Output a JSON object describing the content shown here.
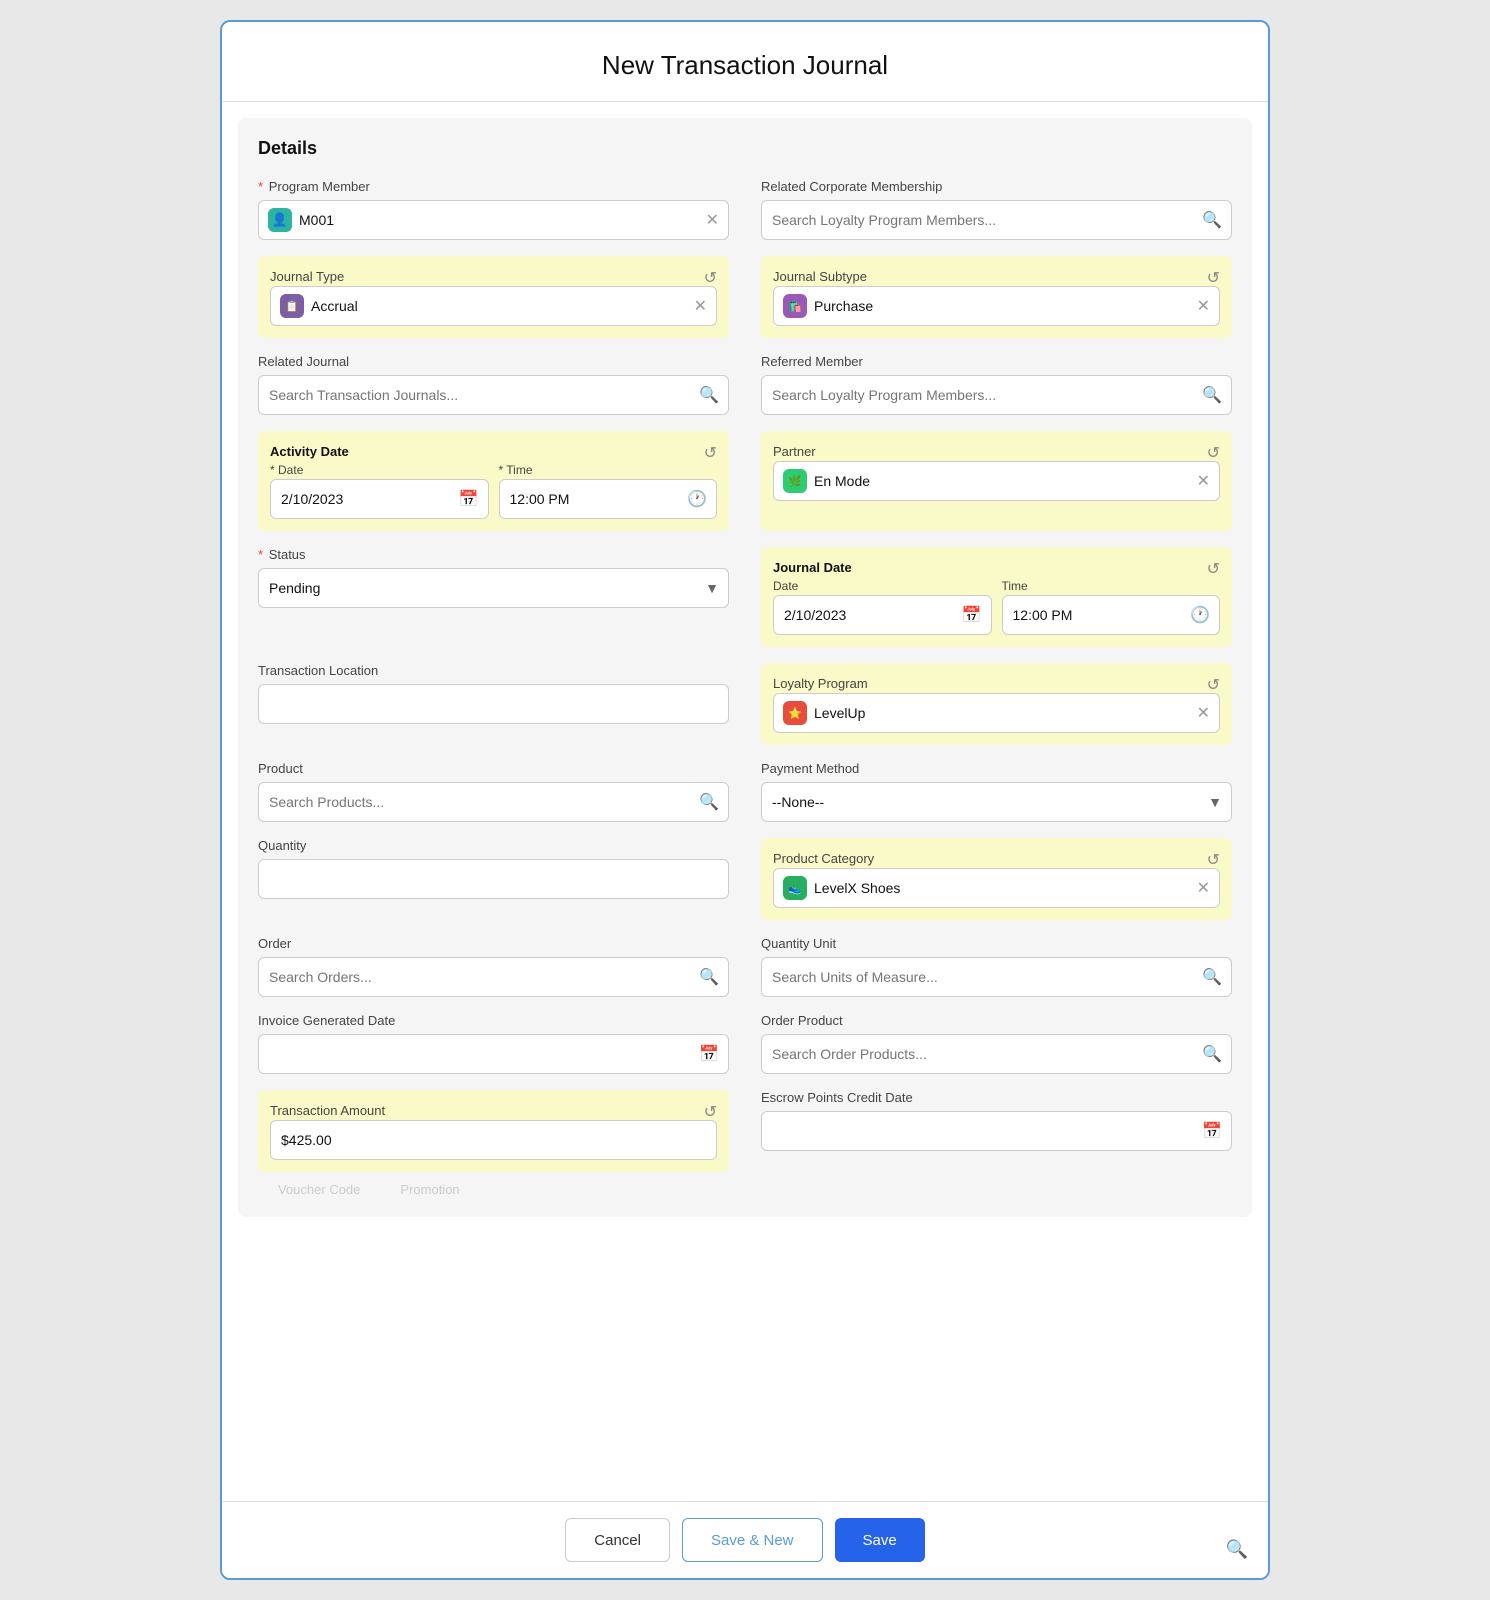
{
  "modal": {
    "title": "New Transaction Journal"
  },
  "section": {
    "title": "Details"
  },
  "fields": {
    "programMember": {
      "label": "Program Member",
      "required": true,
      "value": "M001",
      "iconType": "person"
    },
    "relatedCorporate": {
      "label": "Related Corporate Membership",
      "placeholder": "Search Loyalty Program Members..."
    },
    "journalType": {
      "label": "Journal Type",
      "value": "Accrual",
      "iconType": "accrual"
    },
    "journalSubtype": {
      "label": "Journal Subtype",
      "value": "Purchase",
      "iconType": "purchase"
    },
    "relatedJournal": {
      "label": "Related Journal",
      "placeholder": "Search Transaction Journals..."
    },
    "referredMember": {
      "label": "Referred Member",
      "placeholder": "Search Loyalty Program Members..."
    },
    "activityDate": {
      "label": "Activity Date",
      "dateLabel": "Date",
      "timeLabel": "Time",
      "dateValue": "2/10/2023",
      "timeValue": "12:00 PM"
    },
    "partner": {
      "label": "Partner",
      "value": "En Mode",
      "iconType": "enmode"
    },
    "status": {
      "label": "Status",
      "required": true,
      "value": "Pending"
    },
    "journalDate": {
      "label": "Journal Date",
      "dateLabel": "Date",
      "timeLabel": "Time",
      "dateValue": "2/10/2023",
      "timeValue": "12:00 PM"
    },
    "transactionLocation": {
      "label": "Transaction Location",
      "value": ""
    },
    "loyaltyProgram": {
      "label": "Loyalty Program",
      "value": "LevelUp",
      "iconType": "levelup"
    },
    "product": {
      "label": "Product",
      "placeholder": "Search Products..."
    },
    "paymentMethod": {
      "label": "Payment Method",
      "value": "--None--"
    },
    "quantity": {
      "label": "Quantity",
      "value": ""
    },
    "productCategory": {
      "label": "Product Category",
      "value": "LevelX Shoes",
      "iconType": "levelxshoes"
    },
    "order": {
      "label": "Order",
      "placeholder": "Search Orders..."
    },
    "quantityUnit": {
      "label": "Quantity Unit",
      "placeholder": "Search Units of Measure..."
    },
    "invoiceGeneratedDate": {
      "label": "Invoice Generated Date",
      "value": ""
    },
    "orderProduct": {
      "label": "Order Product",
      "placeholder": "Search Order Products..."
    },
    "transactionAmount": {
      "label": "Transaction Amount",
      "value": "$425.00"
    },
    "escrowPointsCreditDate": {
      "label": "Escrow Points Credit Date",
      "value": ""
    },
    "voucherCode": {
      "label": "Voucher Code"
    },
    "promotion": {
      "label": "Promotion"
    }
  },
  "footer": {
    "cancelLabel": "Cancel",
    "saveNewLabel": "Save & New",
    "saveLabel": "Save"
  }
}
